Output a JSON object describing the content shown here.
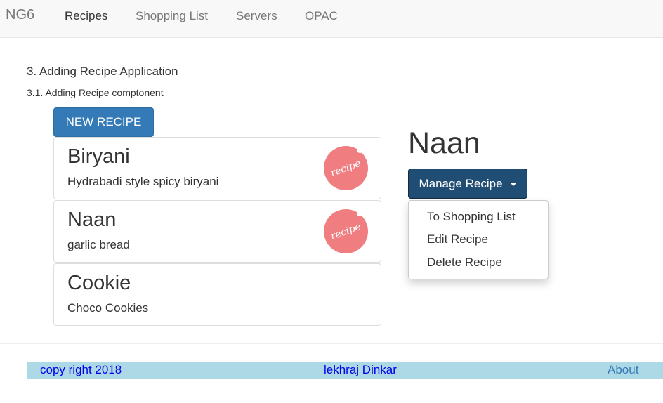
{
  "navbar": {
    "brand": "NG6",
    "links": [
      {
        "label": "Recipes",
        "active": true
      },
      {
        "label": "Shopping List",
        "active": false
      },
      {
        "label": "Servers",
        "active": false
      },
      {
        "label": "OPAC",
        "active": false
      }
    ]
  },
  "headings": {
    "section": "3. Adding Recipe Application",
    "subsection": "3.1. Adding Recipe comptonent"
  },
  "new_recipe_button": "NEW RECIPE",
  "recipes": [
    {
      "name": "Biryani",
      "description": "Hydrabadi style spicy biryani",
      "thumbnail_text": "recipe"
    },
    {
      "name": "Naan",
      "description": "garlic bread",
      "thumbnail_text": "recipe"
    },
    {
      "name": "Cookie",
      "description": "Choco Cookies"
    }
  ],
  "detail": {
    "title": "Naan",
    "manage_button": "Manage Recipe",
    "menu_items": [
      "To Shopping List",
      "Edit Recipe",
      "Delete Recipe"
    ]
  },
  "footer": {
    "copyright": "copy right 2018",
    "author": "lekhraj Dinkar",
    "about": "About"
  },
  "colors": {
    "primary": "#337ab7",
    "manage_button": "#204d74",
    "thumbnail": "#f07d7f",
    "footer_bg": "#add8e6",
    "footer_link": "#0000ee"
  }
}
